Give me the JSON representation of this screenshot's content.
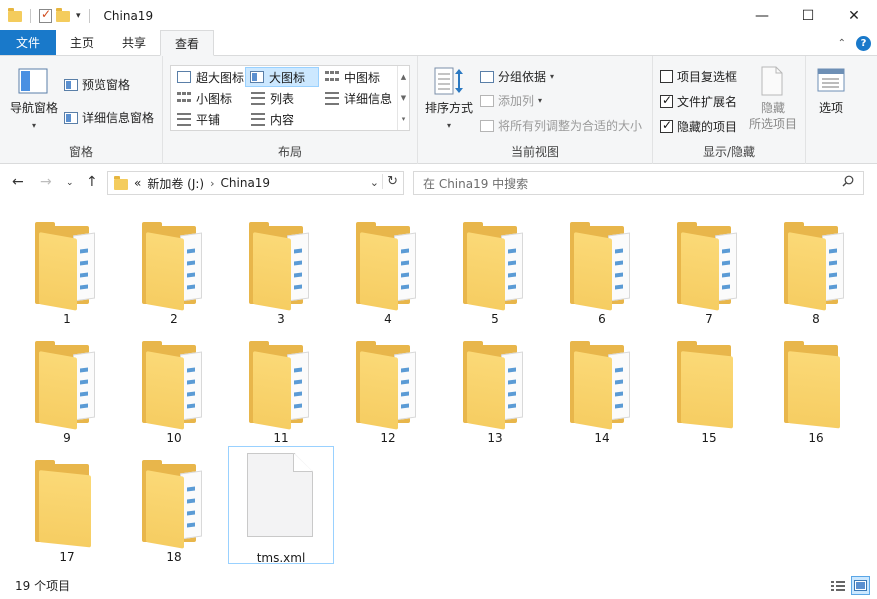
{
  "window": {
    "title": "China19"
  },
  "window_controls": {
    "minimize": "—",
    "maximize": "☐",
    "close": "✕"
  },
  "tabs": [
    {
      "label": "文件"
    },
    {
      "label": "主页"
    },
    {
      "label": "共享"
    },
    {
      "label": "查看"
    }
  ],
  "ribbon": {
    "panes": {
      "label": "窗格",
      "nav_pane": "导航窗格",
      "preview_pane": "预览窗格",
      "details_pane": "详细信息窗格"
    },
    "layout": {
      "label": "布局",
      "items": [
        "超大图标",
        "大图标",
        "中图标",
        "小图标",
        "列表",
        "详细信息",
        "平铺",
        "内容"
      ],
      "selected": "大图标"
    },
    "current_view": {
      "label": "当前视图",
      "sort_by": "排序方式",
      "group_by": "分组依据",
      "add_columns": "添加列",
      "fit_columns": "将所有列调整为合适的大小"
    },
    "show_hide": {
      "label": "显示/隐藏",
      "item_checkboxes": {
        "label": "项目复选框",
        "checked": false
      },
      "file_extensions": {
        "label": "文件扩展名",
        "checked": true
      },
      "hidden_items": {
        "label": "隐藏的项目",
        "checked": true
      },
      "hide_selected_line1": "隐藏",
      "hide_selected_line2": "所选项目"
    },
    "options": {
      "label": "选项"
    }
  },
  "address": {
    "overflow": "«",
    "crumbs": [
      "新加卷 (J:)",
      "China19"
    ]
  },
  "search": {
    "placeholder": "在 China19 中搜索"
  },
  "items": [
    {
      "name": "1",
      "type": "folder-files"
    },
    {
      "name": "2",
      "type": "folder-files"
    },
    {
      "name": "3",
      "type": "folder-files"
    },
    {
      "name": "4",
      "type": "folder-files"
    },
    {
      "name": "5",
      "type": "folder-files"
    },
    {
      "name": "6",
      "type": "folder-files"
    },
    {
      "name": "7",
      "type": "folder-files"
    },
    {
      "name": "8",
      "type": "folder-files"
    },
    {
      "name": "9",
      "type": "folder-files"
    },
    {
      "name": "10",
      "type": "folder-files"
    },
    {
      "name": "11",
      "type": "folder-files"
    },
    {
      "name": "12",
      "type": "folder-files"
    },
    {
      "name": "13",
      "type": "folder-files"
    },
    {
      "name": "14",
      "type": "folder-files"
    },
    {
      "name": "15",
      "type": "folder-empty"
    },
    {
      "name": "16",
      "type": "folder-empty"
    },
    {
      "name": "17",
      "type": "folder-empty"
    },
    {
      "name": "18",
      "type": "folder-files"
    },
    {
      "name": "tms.xml",
      "type": "file",
      "selected": true
    }
  ],
  "status": {
    "count": "19 个项目"
  },
  "colors": {
    "accent": "#1979ca",
    "folder": "#f6cd62",
    "selection": "#cce8ff"
  }
}
